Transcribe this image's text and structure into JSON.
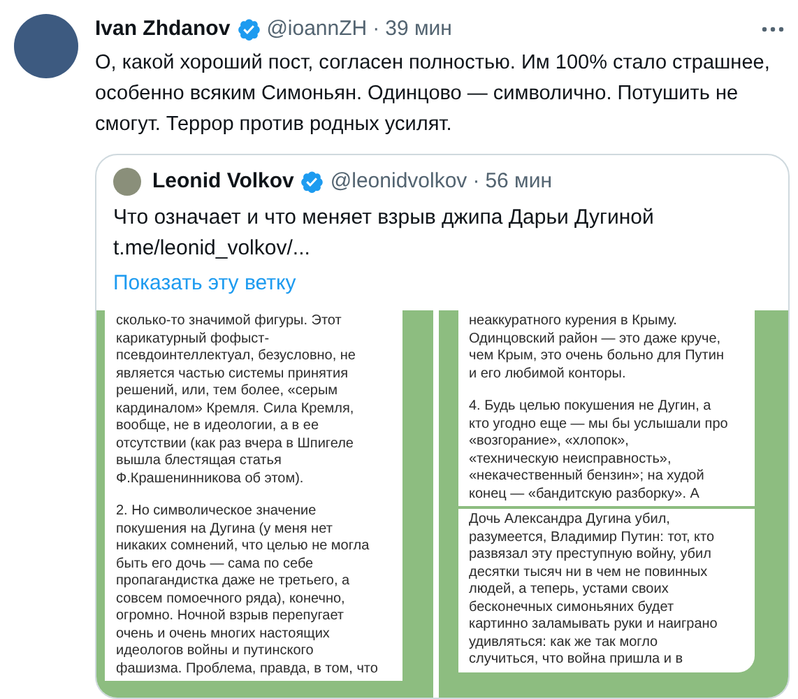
{
  "tweet": {
    "name": "Ivan Zhdanov",
    "verified": true,
    "handle": "@ioannZH",
    "separator": "·",
    "time": "39 мин",
    "text": "О, какой хороший пост, согласен полностью. Им 100% стало страшнее, особенно всяким Симоньян. Одинцово — символично. Потушить не смогут. Террор против родных усилят."
  },
  "quote": {
    "name": "Leonid Volkov",
    "verified": true,
    "handle": "@leonidvolkov",
    "separator": "·",
    "time": "56 мин",
    "text": "Что означает и что меняет взрыв джипа Дарьи Дугиной",
    "link": "t.me/leonid_volkov/...",
    "show_thread": "Показать эту ветку"
  },
  "images": [
    {
      "bubbles": [
        {
          "paragraphs": [
            [
              "сколько-то значимой фигуры. Этот",
              "карикатурный фофыст-",
              "псевдоинтеллектуал, безусловно, не",
              "является частью системы принятия",
              "решений, или, тем более, «серым",
              "кардиналом» Кремля. Сила Кремля,",
              "вообще, не в идеологии, а в ее",
              "отсутствии (как раз вчера в Шпигеле",
              "вышла блестящая статья",
              "Ф.Крашенинникова об этом)."
            ],
            [
              "2. Но символическое значение",
              "покушения на Дугина (у меня нет",
              "никаких сомнений, что целью не могла",
              "быть его дочь — сама по себе",
              "пропагандистка даже не третьего, а",
              "совсем помоечного ряда), конечно,",
              "огромно. Ночной взрыв перепугает",
              "очень и очень многих настоящих",
              "идеологов войны и путинского",
              "фашизма. Проблема, правда, в том, что"
            ]
          ]
        }
      ]
    },
    {
      "bubbles": [
        {
          "paragraphs": [
            [
              "неаккуратного курения в Крыму.",
              "Одинцовский район — это даже круче,",
              "чем Крым, это очень больно для Путин",
              "и его любимой конторы."
            ],
            [
              "4. Будь целью покушения не Дугин, а",
              "кто угодно еще — мы бы услышали про",
              "«возгорание», «хлопок»,",
              "«техническую неисправность»,",
              "«некачественный бензин»; на худой",
              "конец — «бандитскую разборку». А"
            ]
          ]
        },
        {
          "paragraphs": [
            [
              "Дочь Александра Дугина убил,",
              "разумеется, Владимир Путин: тот, кто",
              "развязал эту преступную войну, убил",
              "десятки тысяч ни в чем не повинных",
              "людей, а теперь, устами своих",
              "бесконечных симоньяних будет",
              "картинно заламывать руки и наиграно",
              "удивляться: как же так могло",
              "случиться, что война пришла и в"
            ]
          ]
        }
      ]
    }
  ]
}
